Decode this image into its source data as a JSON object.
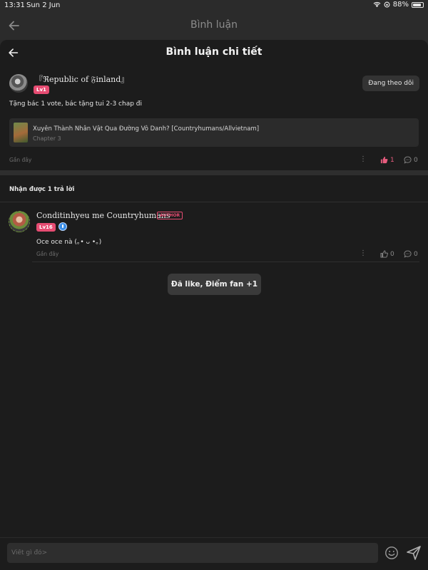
{
  "status_bar": {
    "time": "13:31",
    "date": "Sun 2 Jun",
    "battery": "88%",
    "battery_level": 0.88
  },
  "outer_header": {
    "title": "Bình luận"
  },
  "sheet": {
    "title": "Bình luận chi tiết"
  },
  "comment": {
    "username": "『ℜepublic of 𝔉inland』",
    "level": "Lv1",
    "follow_label": "Đang theo dõi",
    "text": "Tặng bác 1 vote, bác tặng tui 2-3 chap đi",
    "book": {
      "title": "Xuyên Thành Nhân Vật Qua Đường Vô Danh? [Countryhumans/Allvietnam]",
      "chapter": "Chapter 3"
    },
    "time": "Gần đây",
    "likes": "1",
    "replies": "0"
  },
  "replies_header": "Nhận được 1 trả lời",
  "reply": {
    "username": "Conditinhyeu me Countryhumans",
    "author_badge": "AUTHOR",
    "level": "Lv16",
    "text": "Oce oce nà (｡• ᴗ •｡)",
    "time": "Gần đây",
    "likes": "0",
    "replies": "0"
  },
  "toast": "Đã like, Điểm fan +1",
  "input": {
    "placeholder": "Viết gì đó>"
  },
  "colors": {
    "accent": "#e64c72",
    "background": "#1c1c1c",
    "liked": "#e85c7e"
  }
}
